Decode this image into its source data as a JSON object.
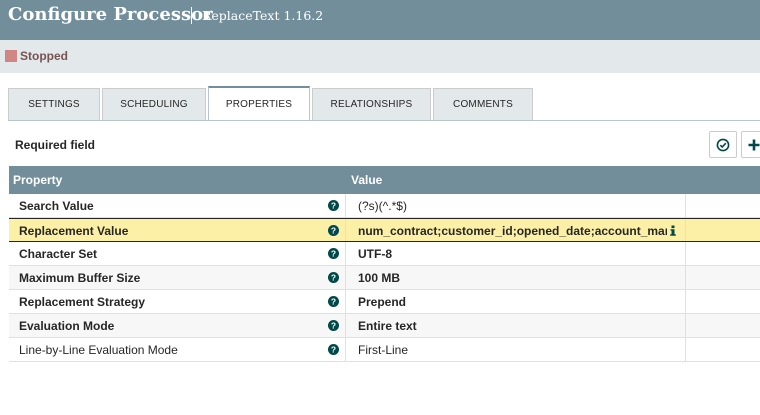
{
  "header": {
    "title": "Configure Processor",
    "subtitle": "ReplaceText 1.16.2"
  },
  "status": {
    "label": "Stopped",
    "color": "#d18686"
  },
  "tabs": [
    {
      "label": "SETTINGS",
      "active": false
    },
    {
      "label": "SCHEDULING",
      "active": false
    },
    {
      "label": "PROPERTIES",
      "active": true
    },
    {
      "label": "RELATIONSHIPS",
      "active": false
    },
    {
      "label": "COMMENTS",
      "active": false
    }
  ],
  "properties": {
    "required_label": "Required field",
    "toolbar_icons": [
      "verify-icon",
      "add-property-icon"
    ],
    "columns": [
      "Property",
      "Value"
    ],
    "rows": [
      {
        "name": "Search Value",
        "value": "(?s)(^.*$)",
        "required": true
      },
      {
        "name": "Replacement Value",
        "value": "num_contract;customer_id;opened_date;account_manage",
        "required": true,
        "selected": true
      },
      {
        "name": "Character Set",
        "value": "UTF-8",
        "required": true
      },
      {
        "name": "Maximum Buffer Size",
        "value": "100 MB",
        "required": true
      },
      {
        "name": "Replacement Strategy",
        "value": "Prepend",
        "required": true
      },
      {
        "name": "Evaluation Mode",
        "value": "Entire text",
        "required": true
      },
      {
        "name": "Line-by-Line Evaluation Mode",
        "value": "First-Line",
        "required": false
      }
    ]
  },
  "colors": {
    "header_bg": "#728e9b",
    "selected_row": "#fcf0a6",
    "accent": "#004849"
  }
}
